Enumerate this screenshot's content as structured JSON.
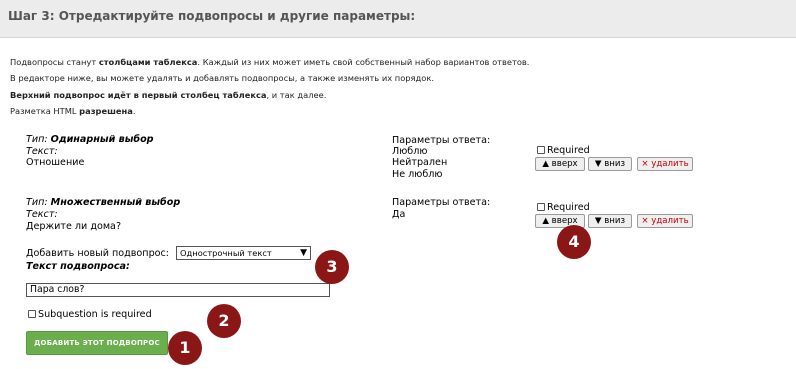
{
  "header": {
    "title": "Шаг 3: Отредактируйте подвопросы и другие параметры:"
  },
  "intro": {
    "line1_pre": "Подвопросы станут ",
    "line1_bold": "столбцами таблекса",
    "line1_post": ". Каждый из них может иметь свой собственный набор вариантов ответов.",
    "line2": "В редакторе ниже, вы можете удалять и добавлять подвопросы, а также изменять их порядок.",
    "line3_bold": "Верхний подвопрос идёт в первый столбец таблекса",
    "line3_post": ", и так далее.",
    "line4_pre": "Разметка HTML ",
    "line4_bold": "разрешена",
    "line4_post": "."
  },
  "subquestions": [
    {
      "type_label": "Тип:",
      "type_value": "Одинарный выбор",
      "text_label": "Текст:",
      "text_value": "Отношение",
      "params_label": "Параметры ответа:",
      "options": [
        "Люблю",
        "Нейтрален",
        "Не люблю"
      ],
      "required_label": "Required",
      "up_label": "▲ вверх",
      "down_label": "▼ вниз",
      "delete_label": "× удалить"
    },
    {
      "type_label": "Тип:",
      "type_value": "Множественный выбор",
      "text_label": "Текст:",
      "text_value": "Держите ли дома?",
      "params_label": "Параметры ответа:",
      "options": [
        "Да"
      ],
      "required_label": "Required",
      "up_label": "▲ вверх",
      "down_label": "▼ вниз",
      "delete_label": "× удалить"
    }
  ],
  "add_form": {
    "add_label": "Добавить новый подвопрос:",
    "type_select_value": "Однострочный текст",
    "text_label": "Текст подвопроса:",
    "text_input_value": "Пара слов?",
    "required_label": "Subquestion is required",
    "submit_label": "ДОБАВИТЬ ЭТОТ ПОДВОПРОС"
  },
  "badges": [
    "1",
    "2",
    "3",
    "4"
  ],
  "colors": {
    "header_bg": "#ececec",
    "add_button": "#6bae4d",
    "badge": "#8a1716",
    "delete_text": "#cc0000"
  }
}
